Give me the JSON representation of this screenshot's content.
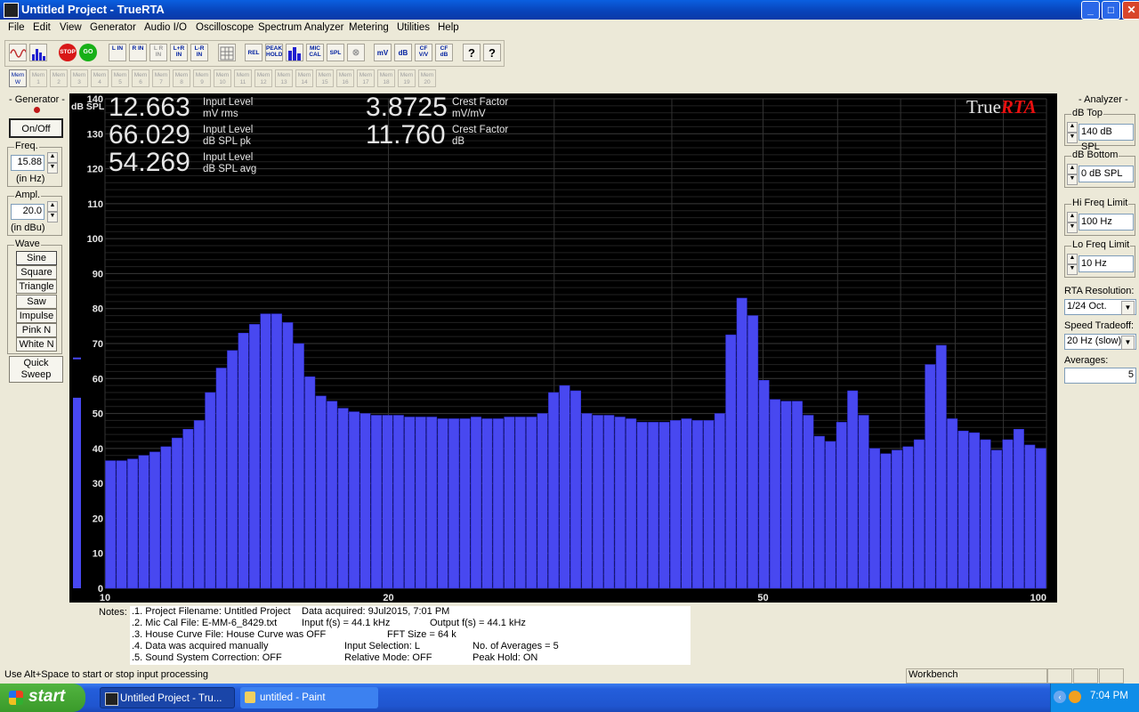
{
  "window": {
    "title": "Untitled Project - TrueRTA"
  },
  "menu": [
    "File",
    "Edit",
    "View",
    "Generator",
    "Audio I/O",
    "Oscilloscope",
    "Spectrum Analyzer",
    "Metering",
    "Utilities",
    "Help"
  ],
  "toolbar": {
    "buttons": [
      "REL",
      "PEAK HOLD",
      "",
      "MIC CAL",
      "SPL",
      "",
      "mV",
      "dB",
      "CF V/V",
      "CF dB",
      "?",
      "?"
    ],
    "channel_buttons": [
      "L IN",
      "R IN",
      "L R IN",
      "L+R IN",
      "L-R IN"
    ],
    "stop_label": "STOP",
    "go_label": "GO"
  },
  "memory": [
    "Mem W",
    "Mem 1",
    "Mem 2",
    "Mem 3",
    "Mem 4",
    "Mem 5",
    "Mem 6",
    "Mem 7",
    "Mem 8",
    "Mem 9",
    "Mem 10",
    "Mem 11",
    "Mem 12",
    "Mem 13",
    "Mem 14",
    "Mem 15",
    "Mem 16",
    "Mem 17",
    "Mem 18",
    "Mem 19",
    "Mem 20"
  ],
  "generator": {
    "title": "- Generator -",
    "onoff": "On/Off",
    "freq_label": "Freq.",
    "freq_value": "15.88",
    "freq_unit": "(in Hz)",
    "ampl_label": "Ampl.",
    "ampl_value": "20.0",
    "ampl_unit": "(in dBu)",
    "wave_label": "Wave",
    "waves": [
      "Sine",
      "Square",
      "Triangle",
      "Saw",
      "Impulse",
      "Pink N",
      "White N"
    ],
    "quick_sweep": "Quick Sweep"
  },
  "readouts": [
    {
      "value": "12.663",
      "label1": "Input Level",
      "label2": "mV rms"
    },
    {
      "value": "66.029",
      "label1": "Input Level",
      "label2": "dB SPL pk"
    },
    {
      "value": "54.269",
      "label1": "Input Level",
      "label2": "dB SPL avg"
    },
    {
      "value": "3.8725",
      "label1": "Crest Factor",
      "label2": "mV/mV"
    },
    {
      "value": "11.760",
      "label1": "Crest Factor",
      "label2": "dB"
    }
  ],
  "brand": {
    "part1": "True",
    "part2": "RTA"
  },
  "chart_data": {
    "type": "bar",
    "ylabel": "dB SPL",
    "ylim": [
      0,
      140
    ],
    "yticks": [
      0,
      10,
      20,
      30,
      40,
      50,
      60,
      70,
      80,
      90,
      100,
      110,
      120,
      130,
      140
    ],
    "x_scale": "log",
    "xlim": [
      10,
      100
    ],
    "xtick_labels": [
      "10",
      "20",
      "50",
      "100"
    ],
    "xtick_values": [
      10,
      20,
      50,
      100
    ],
    "resolution": "1/24 Oct.",
    "values": [
      36.5,
      36.5,
      37,
      38,
      39,
      40.5,
      43,
      45.5,
      48,
      56,
      63,
      68,
      73,
      75.5,
      78.5,
      78.5,
      76,
      70,
      60.5,
      55,
      53.5,
      51.5,
      50.5,
      50,
      49.5,
      49.5,
      49.5,
      49,
      49,
      49,
      48.5,
      48.5,
      48.5,
      49,
      48.5,
      48.5,
      49,
      49,
      49,
      50,
      56,
      58,
      56.5,
      50,
      49.5,
      49.5,
      49,
      48.5,
      47.5,
      47.5,
      47.5,
      48,
      48.5,
      48,
      48,
      50,
      72.5,
      83,
      78,
      59.5,
      54,
      53.5,
      53.5,
      49.5,
      43.5,
      42,
      47.5,
      56.5,
      49.5,
      40,
      38.5,
      39.5,
      40.5,
      42.5,
      64,
      69.5,
      48.5,
      45,
      44.5,
      42.5,
      39.5,
      42.5,
      45.5,
      41,
      40
    ],
    "level_meter": 54.5,
    "level_peak": 66
  },
  "analyzer": {
    "title": "- Analyzer -",
    "db_top_label": "dB Top",
    "db_top_value": "140 dB SPL",
    "db_bottom_label": "dB Bottom",
    "db_bottom_value": "0 dB SPL",
    "hi_label": "Hi Freq Limit",
    "hi_value": "100 Hz",
    "lo_label": "Lo Freq Limit",
    "lo_value": "10 Hz",
    "res_label": "RTA Resolution:",
    "res_value": "1/24 Oct.",
    "speed_label": "Speed Tradeoff:",
    "speed_value": "20 Hz (slow)",
    "avg_label": "Averages:",
    "avg_value": "5"
  },
  "notes": {
    "label": "Notes:",
    "lines": [
      [
        ".1. Project Filename: Untitled Project",
        "Data acquired: 9Jul2015, 7:01 PM",
        ""
      ],
      [
        ".2. Mic Cal File: E-MM-6_8429.txt",
        "Input f(s) = 44.1 kHz",
        "Output f(s) = 44.1 kHz"
      ],
      [
        ".3. House Curve File: House Curve was OFF",
        "FFT Size = 64 k",
        ""
      ],
      [
        ".4. Data was acquired manually",
        "Input Selection: L",
        "No. of Averages = 5"
      ],
      [
        ".5. Sound System Correction: OFF",
        "Relative Mode:  OFF",
        "Peak Hold: ON"
      ]
    ]
  },
  "status": {
    "hint": "Use Alt+Space to start or stop input processing",
    "mode": "Workbench"
  },
  "taskbar": {
    "start": "start",
    "tasks": [
      "Untitled Project - Tru...",
      "untitled - Paint"
    ],
    "clock": "7:04 PM"
  },
  "colors": {
    "bar": "#4848f0",
    "bar_edge": "#2a2ad0",
    "grid": "#303030",
    "accent": "#e81010"
  }
}
